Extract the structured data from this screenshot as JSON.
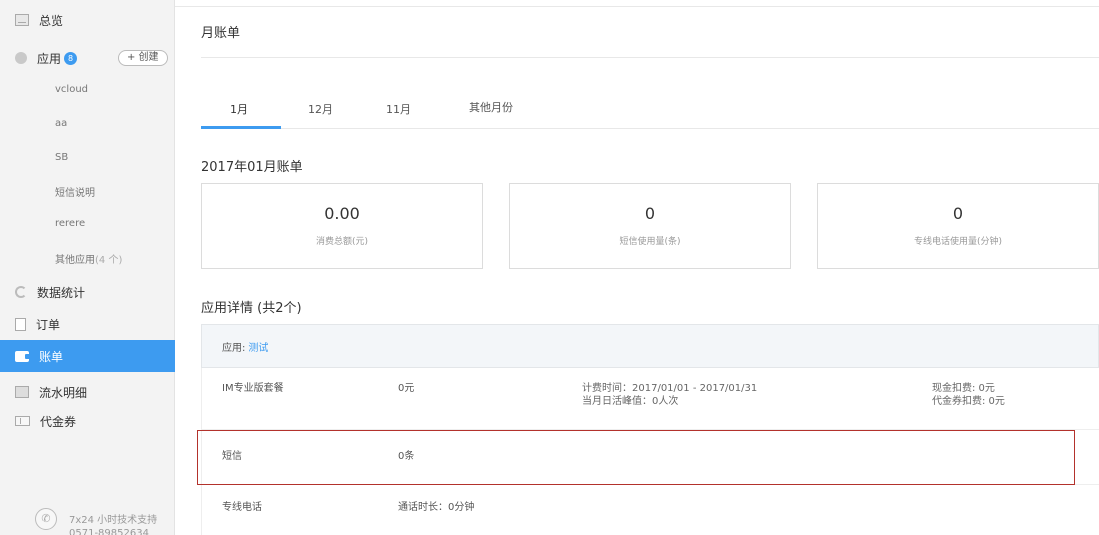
{
  "sidebar": {
    "items": [
      {
        "label": "总览",
        "icon": "dashboard-icon"
      },
      {
        "label": "应用",
        "badge": "8",
        "icon": "cube-icon"
      },
      {
        "label": "数据统计",
        "icon": "chart-icon"
      },
      {
        "label": "订单",
        "icon": "order-icon"
      },
      {
        "label": "账单",
        "icon": "wallet-icon",
        "active": true
      },
      {
        "label": "流水明细",
        "icon": "list-icon"
      },
      {
        "label": "代金券",
        "icon": "coupon-icon"
      }
    ],
    "create_label": "+ 创建",
    "apps": [
      "vcloud",
      "aa",
      "SB",
      "短信说明",
      "rerere"
    ],
    "other_apps_label": "其他应用",
    "other_apps_count": "(4 个)",
    "support_line1": "7x24 小时技术支持",
    "support_line2": "0571-89852634"
  },
  "main": {
    "title": "月账单",
    "tabs": [
      "1月",
      "12月",
      "11月",
      "其他月份"
    ],
    "active_tab": 0,
    "bill_title": "2017年01月账单",
    "stats": [
      {
        "value": "0.00",
        "label": "消费总额(元)"
      },
      {
        "value": "0",
        "label": "短信使用量(条)"
      },
      {
        "value": "0",
        "label": "专线电话使用量(分钟)"
      }
    ],
    "detail_title": "应用详情 (共2个)",
    "app_label": "应用:",
    "app_name": "测试",
    "rows": {
      "im": {
        "name": "IM专业版套餐",
        "amount": "0元",
        "period": "计费时间：2017/01/01 - 2017/01/31",
        "peak": "当月日活峰值：0人次",
        "cash": "现金扣费: 0元",
        "coupon": "代金券扣费: 0元"
      },
      "sms": {
        "name": "短信",
        "amount": "0条"
      },
      "phone": {
        "name": "专线电话",
        "amount": "通话时长：0分钟"
      }
    }
  },
  "colors": {
    "accent": "#3d9bf0",
    "highlight_border": "#b3322c",
    "sidebar_bg": "#f3f3f3"
  }
}
